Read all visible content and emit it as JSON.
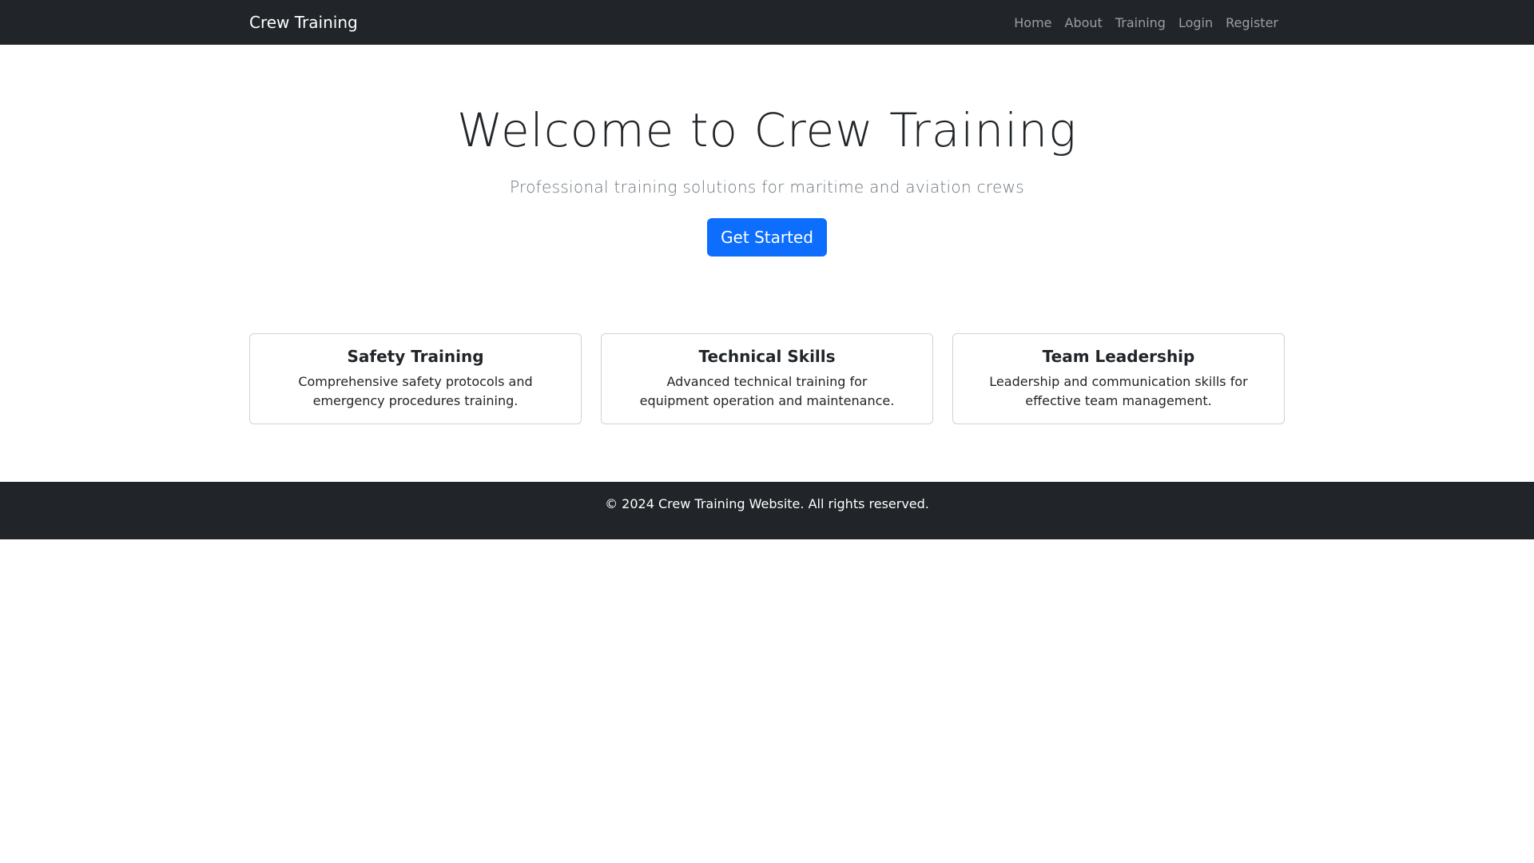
{
  "navbar": {
    "brand": "Crew Training",
    "links": [
      {
        "label": "Home"
      },
      {
        "label": "About"
      },
      {
        "label": "Training"
      },
      {
        "label": "Login"
      },
      {
        "label": "Register"
      }
    ]
  },
  "hero": {
    "title": "Welcome to Crew Training",
    "subtitle": "Professional training solutions for maritime and aviation crews",
    "cta_label": "Get Started"
  },
  "cards": [
    {
      "title": "Safety Training",
      "text": "Comprehensive safety protocols and emergency procedures training."
    },
    {
      "title": "Technical Skills",
      "text": "Advanced technical training for equipment operation and maintenance."
    },
    {
      "title": "Team Leadership",
      "text": "Leadership and communication skills for effective team management."
    }
  ],
  "footer": {
    "text": "© 2024 Crew Training Website. All rights reserved."
  },
  "colors": {
    "navbar_bg": "#212529",
    "primary": "#0d6efd",
    "muted": "#6c757d"
  }
}
